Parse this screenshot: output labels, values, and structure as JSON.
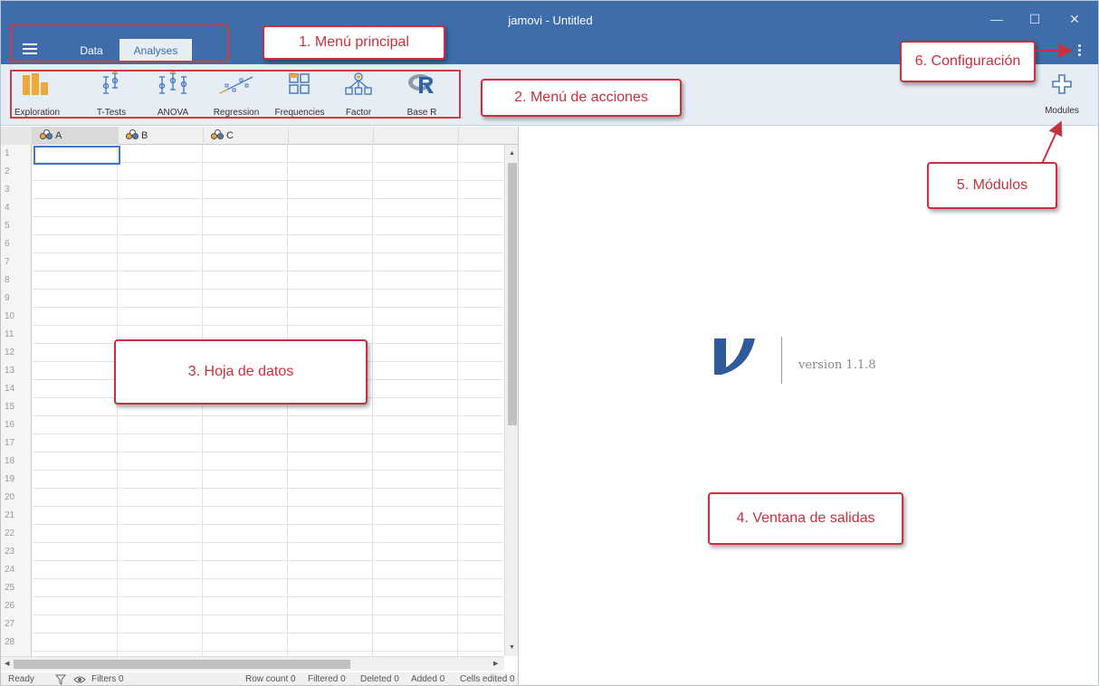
{
  "window": {
    "title": "jamovi - Untitled",
    "controls": {
      "minimize": "—",
      "maximize": "☐",
      "close": "✕"
    }
  },
  "main_tabs": [
    {
      "label": "Data",
      "active": false
    },
    {
      "label": "Analyses",
      "active": true
    }
  ],
  "ribbon": {
    "items": [
      {
        "label": "Exploration",
        "icon": "exploration-icon"
      },
      {
        "label": "T-Tests",
        "icon": "t-tests-icon"
      },
      {
        "label": "ANOVA",
        "icon": "anova-icon"
      },
      {
        "label": "Regression",
        "icon": "regression-icon"
      },
      {
        "label": "Frequencies",
        "icon": "frequencies-icon"
      },
      {
        "label": "Factor",
        "icon": "factor-icon"
      },
      {
        "label": "Base R",
        "icon": "base-r-icon"
      }
    ],
    "modules_label": "Modules"
  },
  "spreadsheet": {
    "columns": [
      "A",
      "B",
      "C"
    ],
    "row_numbers": [
      "1",
      "2",
      "3",
      "4",
      "5",
      "6",
      "7",
      "8",
      "9",
      "10",
      "11",
      "12",
      "13",
      "14",
      "15",
      "16",
      "17",
      "18",
      "19",
      "20",
      "21",
      "22",
      "23",
      "24",
      "25",
      "26",
      "27",
      "28"
    ]
  },
  "statusbar": {
    "ready": "Ready",
    "filters": "Filters 0",
    "row_count": "Row count 0",
    "filtered": "Filtered 0",
    "deleted": "Deleted 0",
    "added": "Added 0",
    "cells_edited": "Cells edited 0"
  },
  "output": {
    "version": "version 1.1.8"
  },
  "annotations": {
    "menu_principal": "1. Menú principal",
    "menu_acciones": "2. Menú de acciones",
    "hoja_datos": "3. Hoja de datos",
    "ventana_salidas": "4. Ventana de salidas",
    "modulos": "5. Módulos",
    "configuracion": "6. Configuración"
  },
  "colors": {
    "titlebar": "#3e6da9",
    "ribbon": "#e6edf5",
    "ribbon_icon": "#4a7dbd",
    "exploration_icon": "#f0a73a",
    "annotation": "#c7303d"
  }
}
